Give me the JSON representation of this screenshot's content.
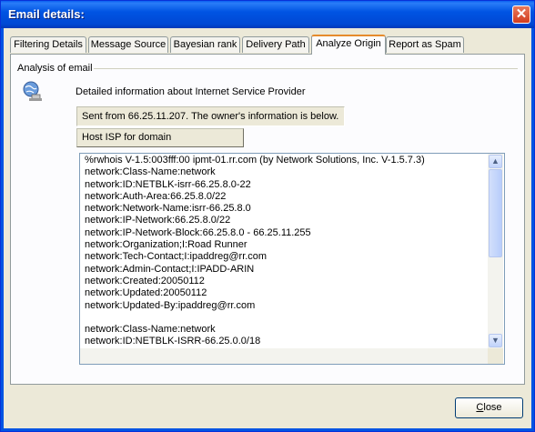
{
  "window": {
    "title": "Email details:"
  },
  "tabs": [
    {
      "label": "Filtering Details"
    },
    {
      "label": "Message Source"
    },
    {
      "label": "Bayesian rank"
    },
    {
      "label": "Delivery Path"
    },
    {
      "label": "Analyze Origin"
    },
    {
      "label": "Report as Spam"
    }
  ],
  "active_tab": "Analyze Origin",
  "analysis": {
    "group_label": "Analysis of email",
    "heading": "Detailed information about Internet Service Provider",
    "info": "Sent from 66.25.11.207. The owner's information is below.",
    "host_button": "Host ISP for domain",
    "lines": [
      "%rwhois V-1.5:003fff:00 ipmt-01.rr.com (by Network Solutions, Inc. V-1.5.7.3)",
      "network:Class-Name:network",
      "network:ID:NETBLK-isrr-66.25.8.0-22",
      "network:Auth-Area:66.25.8.0/22",
      "network:Network-Name:isrr-66.25.8.0",
      "network:IP-Network:66.25.8.0/22",
      "network:IP-Network-Block:66.25.8.0 - 66.25.11.255",
      "network:Organization;I:Road Runner",
      "network:Tech-Contact;I:ipaddreg@rr.com",
      "network:Admin-Contact;I:IPADD-ARIN",
      "network:Created:20050112",
      "network:Updated:20050112",
      "network:Updated-By:ipaddreg@rr.com",
      "",
      "network:Class-Name:network",
      "network:ID:NETBLK-ISRR-66.25.0.0/18"
    ]
  },
  "footer": {
    "close_first": "C",
    "close_rest": "lose"
  }
}
